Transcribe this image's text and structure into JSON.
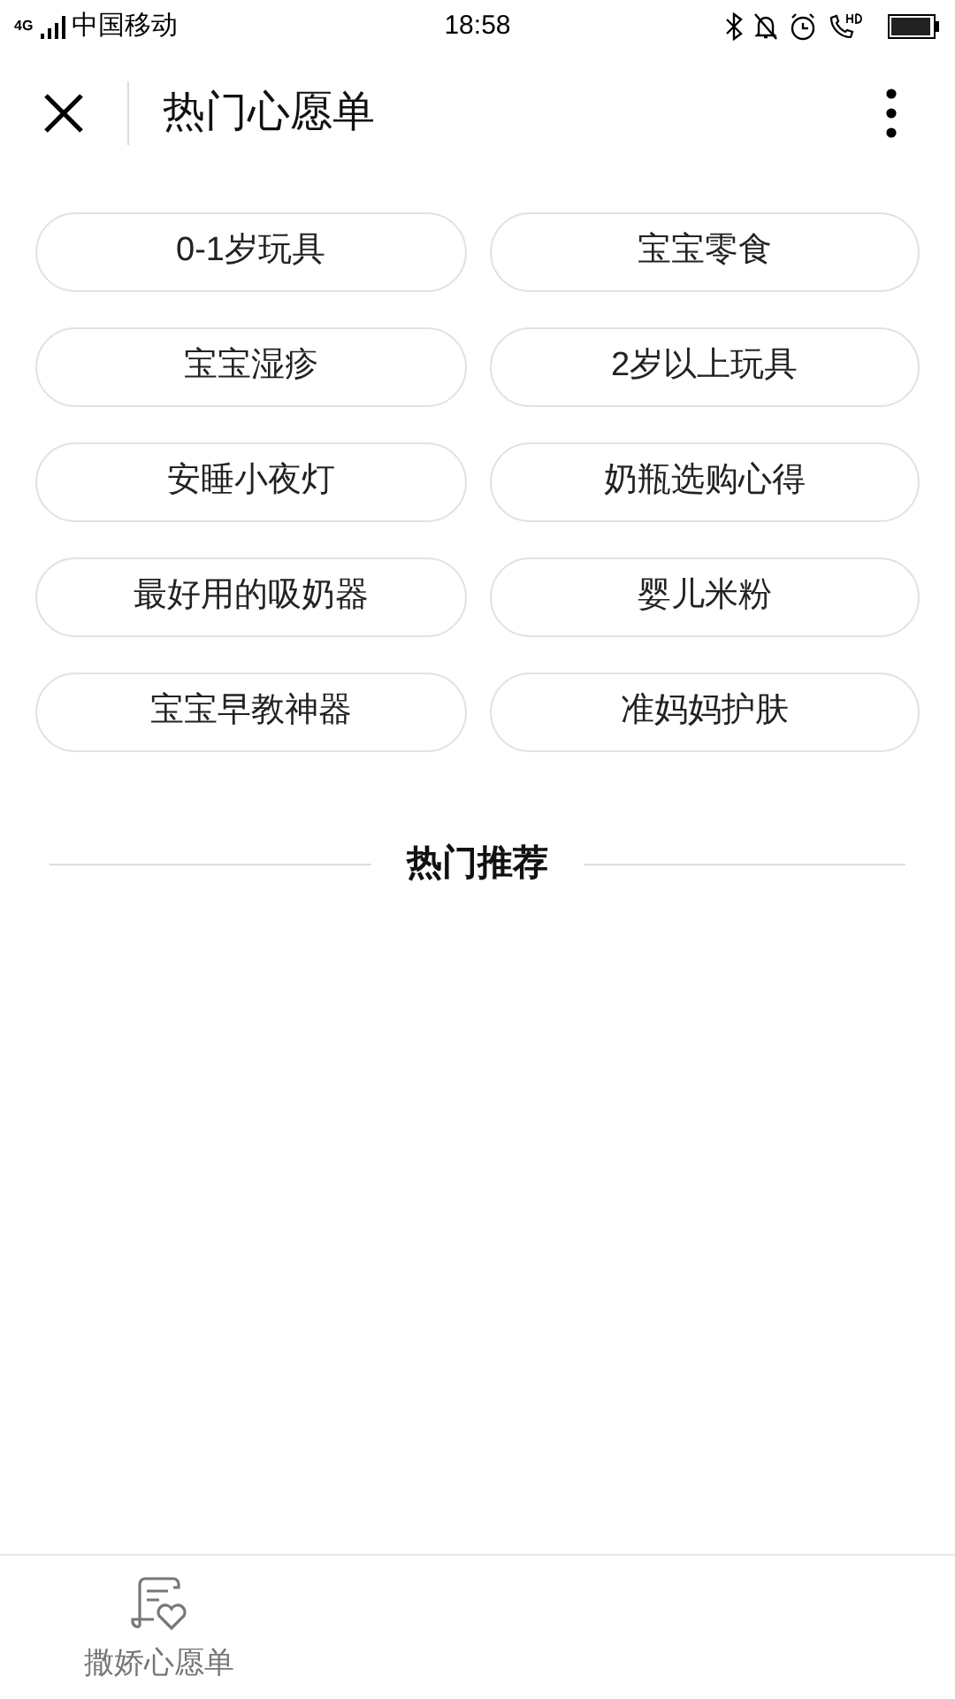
{
  "status_bar": {
    "network": "4G",
    "carrier": "中国移动",
    "time": "18:58"
  },
  "header": {
    "title": "热门心愿单"
  },
  "tags": [
    {
      "label": "0-1岁玩具"
    },
    {
      "label": "宝宝零食"
    },
    {
      "label": "宝宝湿疹"
    },
    {
      "label": "2岁以上玩具"
    },
    {
      "label": "安睡小夜灯"
    },
    {
      "label": "奶瓶选购心得"
    },
    {
      "label": "最好用的吸奶器"
    },
    {
      "label": "婴儿米粉"
    },
    {
      "label": "宝宝早教神器"
    },
    {
      "label": "准妈妈护肤"
    }
  ],
  "section": {
    "title": "热门推荐"
  },
  "tab_bar": [
    {
      "label": "撒娇心愿单"
    }
  ]
}
